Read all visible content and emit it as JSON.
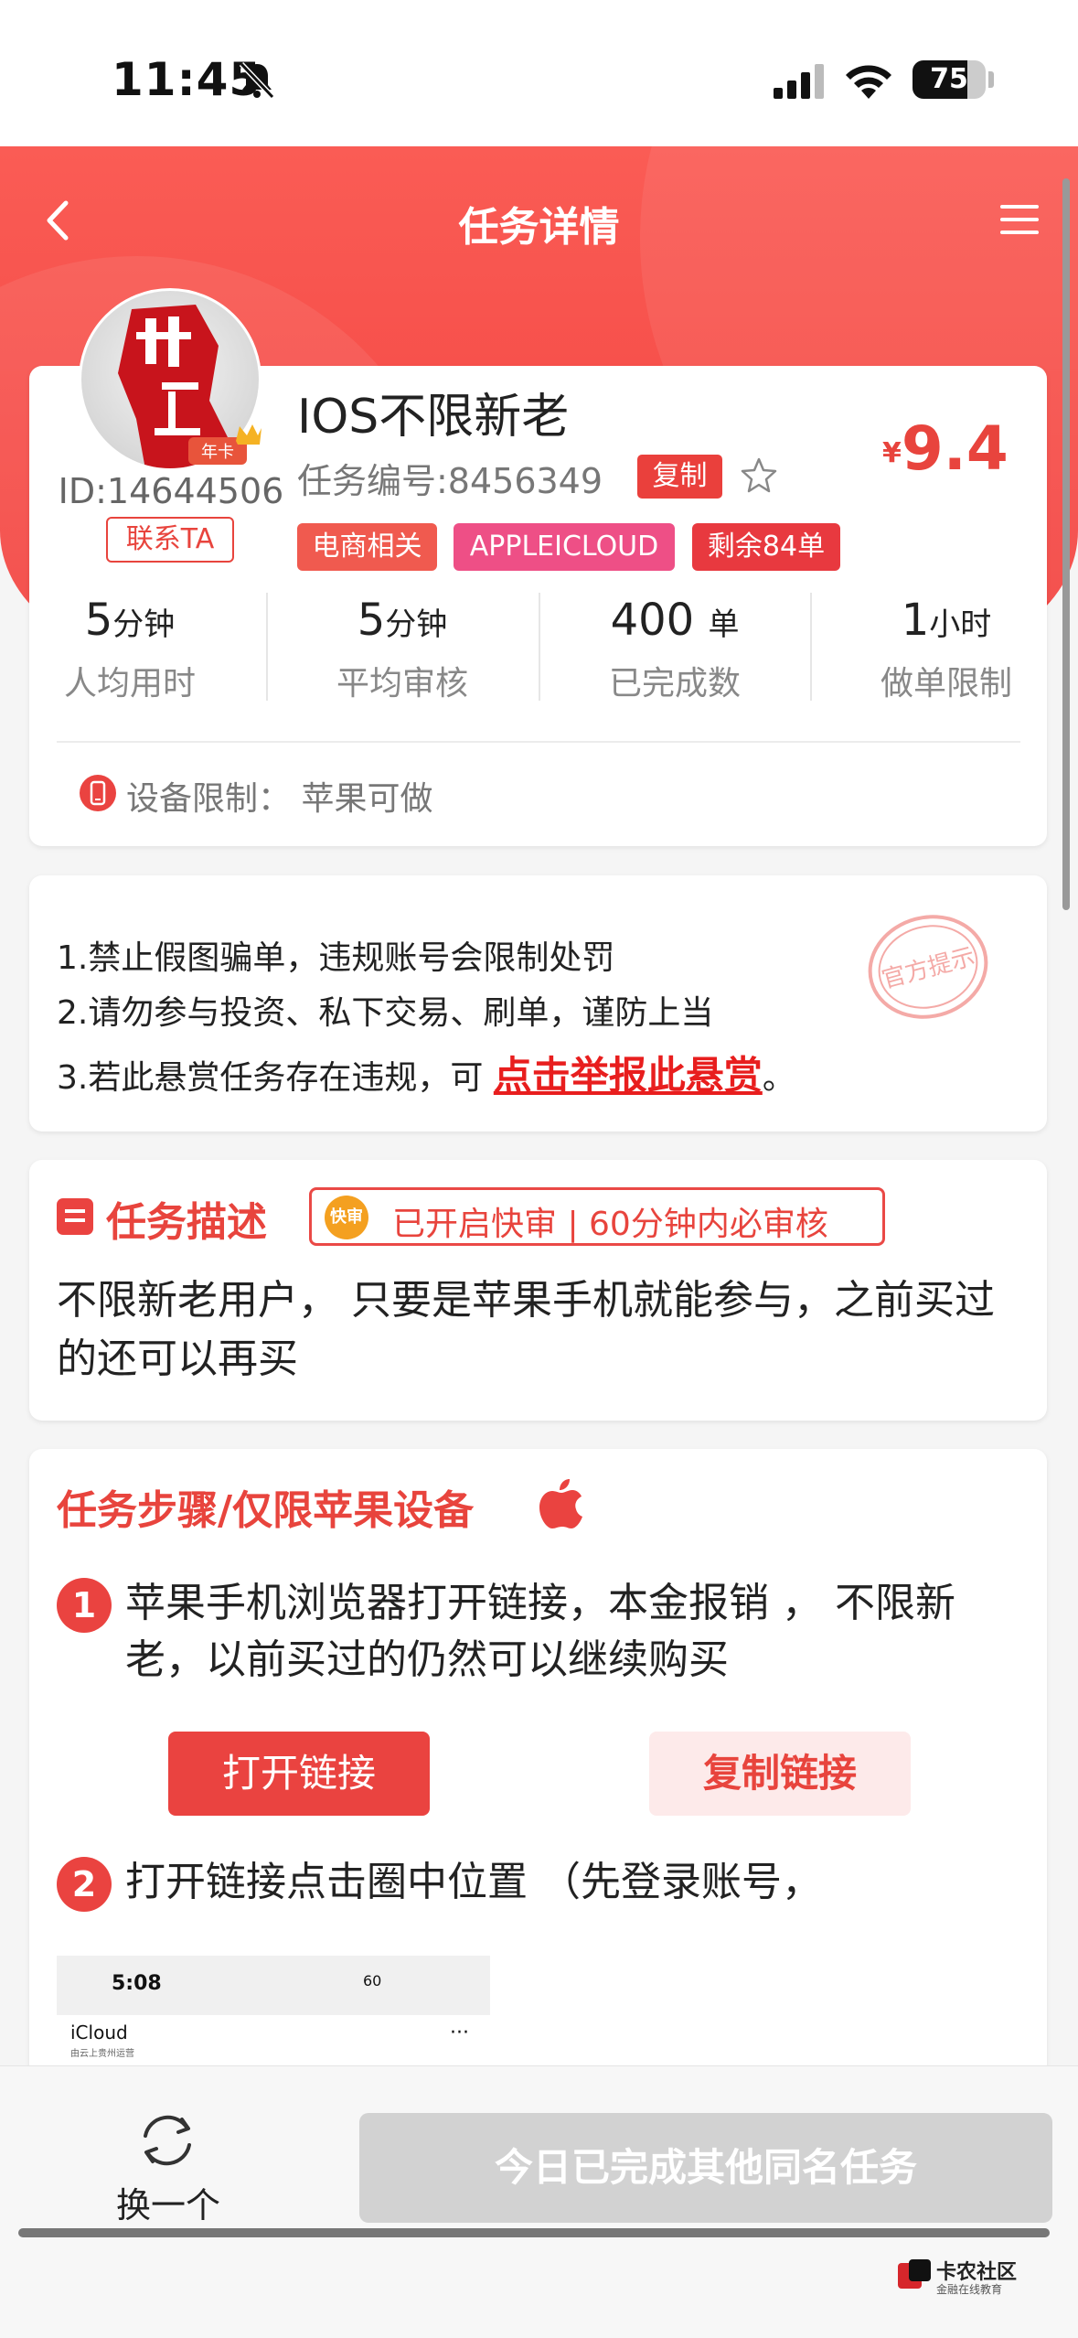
{
  "status_bar": {
    "time": "11:45",
    "battery": "75",
    "battery_level": 0.75
  },
  "nav": {
    "title": "任务详情"
  },
  "user": {
    "id": "ID:14644506",
    "contact_label": "联系TA",
    "badge_text": "年卡"
  },
  "task": {
    "title": "IOS不限新老",
    "number": "任务编号:8456349",
    "copy_label": "复制",
    "price_symbol": "¥",
    "price": "9.4",
    "tags": [
      "电商相关",
      "APPLEICLOUD",
      "剩余84单"
    ]
  },
  "stats": [
    {
      "value": "5",
      "unit": "分钟",
      "label": "人均用时"
    },
    {
      "value": "5",
      "unit": "分钟",
      "label": "平均审核"
    },
    {
      "value": "400 ",
      "unit": "单",
      "label": "已完成数"
    },
    {
      "value": "1",
      "unit": "小时",
      "label": "做单限制"
    }
  ],
  "device_limit": "设备限制：  苹果可做",
  "notice": {
    "line1": "1.禁止假图骗单，违规账号会限制处罚",
    "line2": "2.请勿参与投资、私下交易、刷单，谨防上当",
    "line3_prefix": "3.若此悬赏任务存在违规，可 ",
    "report_link": "点击举报此悬赏",
    "line3_suffix": "。",
    "seal_text": "官方提示"
  },
  "description": {
    "title": "任务描述",
    "fast_icon": "快审",
    "fast_text": "已开启快审 | 60分钟内必审核",
    "text": "不限新老用户， 只要是苹果手机就能参与，之前买过的还可以再买"
  },
  "steps": {
    "title": "任务步骤/仅限苹果设备",
    "items": [
      {
        "num": "1",
        "text": "苹果手机浏览器打开链接，本金报销 ， 不限新老，以前买过的仍然可以继续购买"
      },
      {
        "num": "2",
        "text": "打开链接点击圈中位置 （先登录账号，"
      }
    ],
    "open_link": "打开链接",
    "copy_link": "复制链接",
    "screenshot": {
      "time": "5:08",
      "status": "60",
      "app": "iCloud",
      "sub": "由云上贵州运营",
      "dots": "···"
    }
  },
  "bottom": {
    "refresh_label": "换一个",
    "done_label": "今日已完成其他同名任务"
  },
  "watermark": {
    "name": "卡农社区",
    "sub": "金融在线教育"
  },
  "colors": {
    "accent": "#e8443d",
    "header": "#f3423f",
    "pink_tag": "#ee4f86"
  },
  "icons": [
    "bell-slash-icon",
    "signal-icon",
    "wifi-icon",
    "back-icon",
    "menu-icon",
    "star-icon",
    "phone-icon",
    "apple-icon",
    "refresh-icon"
  ]
}
